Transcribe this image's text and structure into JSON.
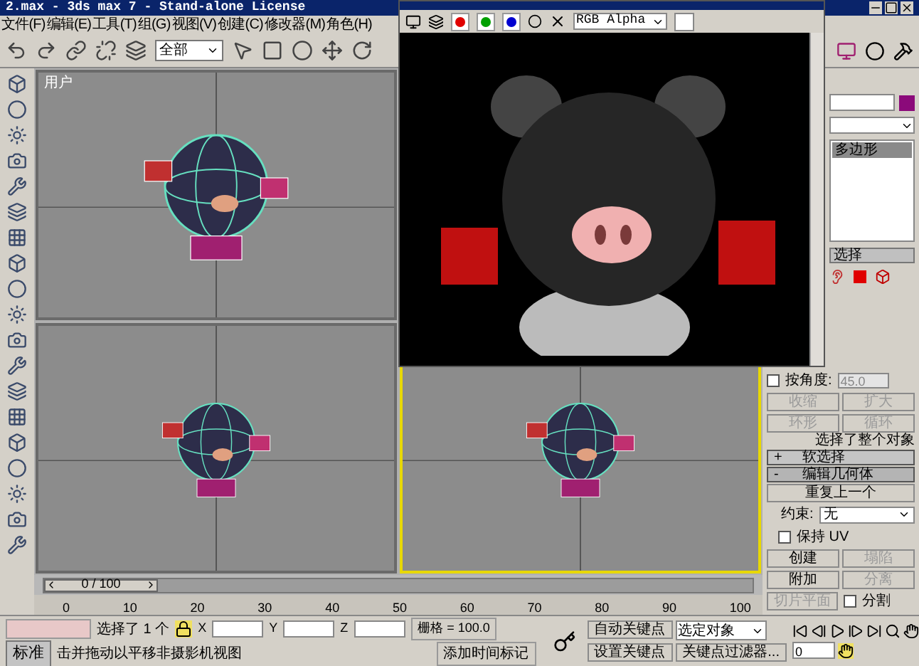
{
  "window": {
    "title": "2.max - 3ds max 7  - Stand-alone License"
  },
  "menu": [
    "文件(F)",
    "编辑(E)",
    "工具(T)",
    "组(G)",
    "视图(V)",
    "创建(C)",
    "修改器(M)",
    "角色(H)"
  ],
  "toolbar": {
    "selection_filter": "全部"
  },
  "viewports": [
    {
      "label": "用户",
      "active": false
    },
    {
      "active": false
    },
    {
      "active": true
    }
  ],
  "render_window": {
    "channel_display": "RGB Alpha"
  },
  "command_panel": {
    "stack_items": [
      {
        "label": "多边形",
        "selected": true
      }
    ],
    "selection_title": "选择",
    "by_angle": {
      "label": "按角度:",
      "checked": false,
      "value": "45.0"
    },
    "selection_buttons": [
      {
        "label": "收缩",
        "disabled": true
      },
      {
        "label": "扩大",
        "disabled": true
      },
      {
        "label": "环形",
        "disabled": true
      },
      {
        "label": "循环",
        "disabled": true
      }
    ],
    "selection_status": "选择了整个对象",
    "rollouts": [
      {
        "sign": "+",
        "title": "软选择",
        "expanded": false
      },
      {
        "sign": "-",
        "title": "编辑几何体",
        "expanded": true
      }
    ],
    "repeat_last": "重复上一个",
    "constraint": {
      "label": "约束:",
      "value": "无"
    },
    "preserve_uv": {
      "label": "保持 UV",
      "checked": false
    },
    "geometry_buttons": [
      {
        "label": "创建",
        "disabled": false
      },
      {
        "label": "塌陷",
        "disabled": true
      },
      {
        "label": "附加",
        "disabled": false
      },
      {
        "label": "分离",
        "disabled": true
      }
    ],
    "slice_plane": {
      "label": "切片平面",
      "disabled": true
    },
    "split": {
      "label": "分割",
      "checked": false
    }
  },
  "time_slider": {
    "label": "0 / 100",
    "level": 0
  },
  "ruler_ticks": [
    "0",
    "10",
    "20",
    "30",
    "40",
    "50",
    "60",
    "70",
    "80",
    "90",
    "100"
  ],
  "status_bar": {
    "selection": "选择了 1 个",
    "locked": true,
    "x_label": "X",
    "y_label": "Y",
    "z_label": "Z",
    "grid": "栅格 = 100.0",
    "auto_key": "自动关键点",
    "key_mode": "选定对象",
    "set_key": "设置关键点",
    "key_filters": "关键点过滤器...",
    "frame": "0",
    "tab": "标准",
    "prompt": "击并拖动以平移非摄影机视图",
    "time_tag": "添加时间标记"
  }
}
